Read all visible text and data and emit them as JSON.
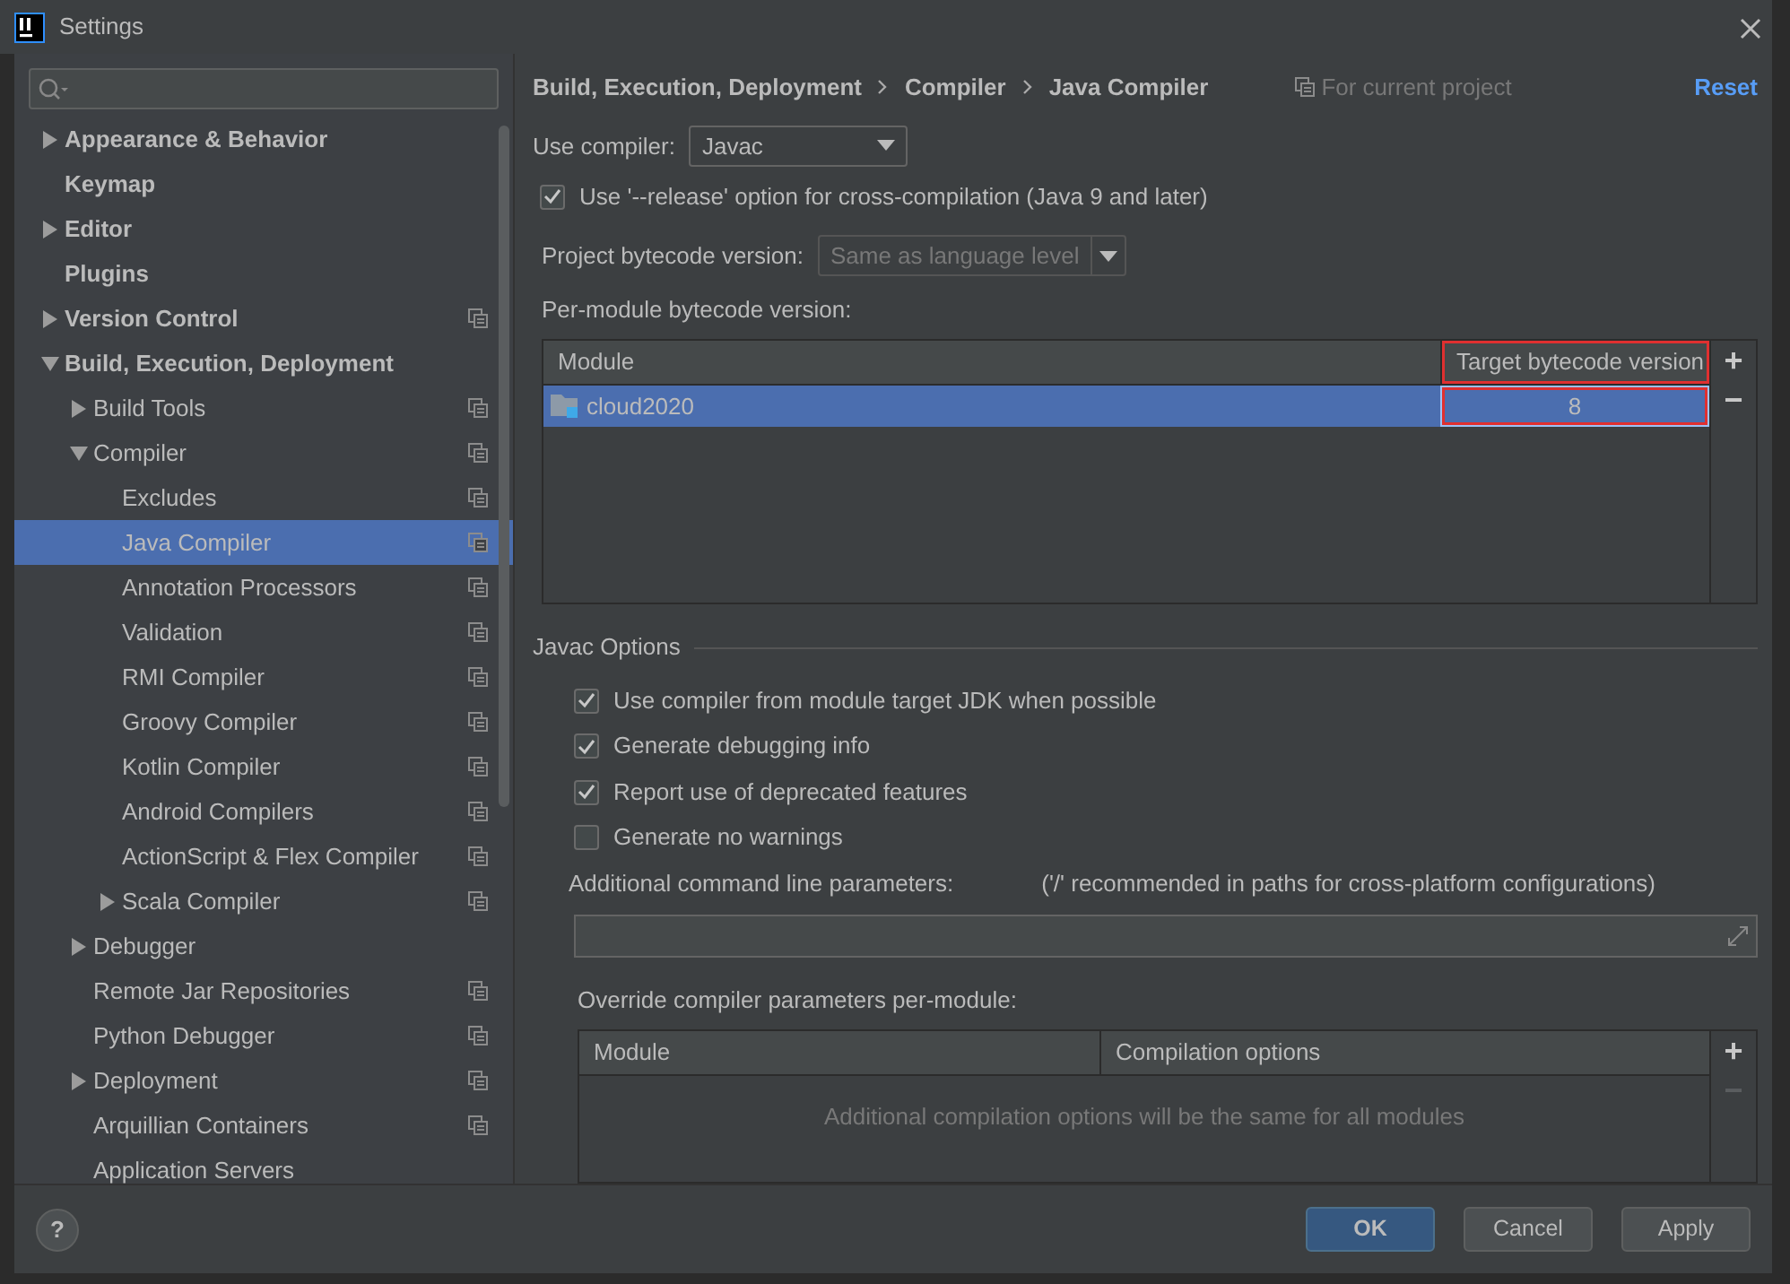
{
  "window": {
    "title": "Settings"
  },
  "sidebar": {
    "items": [
      {
        "label": "Appearance & Behavior",
        "expanded": false,
        "project_scoped": false,
        "selected": false
      },
      {
        "label": "Keymap",
        "project_scoped": false,
        "selected": false
      },
      {
        "label": "Editor",
        "expanded": false,
        "project_scoped": false,
        "selected": false
      },
      {
        "label": "Plugins",
        "project_scoped": false,
        "selected": false
      },
      {
        "label": "Version Control",
        "expanded": false,
        "project_scoped": true,
        "selected": false
      },
      {
        "label": "Build, Execution, Deployment",
        "expanded": true,
        "project_scoped": false,
        "selected": false,
        "children": [
          {
            "label": "Build Tools",
            "expanded": false,
            "project_scoped": true,
            "selected": false
          },
          {
            "label": "Compiler",
            "expanded": true,
            "project_scoped": true,
            "selected": false,
            "children": [
              {
                "label": "Excludes",
                "project_scoped": true,
                "selected": false
              },
              {
                "label": "Java Compiler",
                "project_scoped": true,
                "selected": true
              },
              {
                "label": "Annotation Processors",
                "project_scoped": true,
                "selected": false
              },
              {
                "label": "Validation",
                "project_scoped": true,
                "selected": false
              },
              {
                "label": "RMI Compiler",
                "project_scoped": true,
                "selected": false
              },
              {
                "label": "Groovy Compiler",
                "project_scoped": true,
                "selected": false
              },
              {
                "label": "Kotlin Compiler",
                "project_scoped": true,
                "selected": false
              },
              {
                "label": "Android Compilers",
                "project_scoped": true,
                "selected": false
              },
              {
                "label": "ActionScript & Flex Compiler",
                "project_scoped": true,
                "selected": false
              },
              {
                "label": "Scala Compiler",
                "expanded": false,
                "project_scoped": true,
                "selected": false
              }
            ]
          },
          {
            "label": "Debugger",
            "expanded": false,
            "project_scoped": false,
            "selected": false
          },
          {
            "label": "Remote Jar Repositories",
            "project_scoped": true,
            "selected": false
          },
          {
            "label": "Python Debugger",
            "project_scoped": true,
            "selected": false
          },
          {
            "label": "Deployment",
            "expanded": false,
            "project_scoped": true,
            "selected": false
          },
          {
            "label": "Arquillian Containers",
            "project_scoped": true,
            "selected": false
          },
          {
            "label": "Application Servers",
            "project_scoped": false,
            "selected": false
          }
        ]
      }
    ]
  },
  "breadcrumb": [
    "Build, Execution, Deployment",
    "Compiler",
    "Java Compiler"
  ],
  "scope_note": "For current project",
  "reset_link": "Reset",
  "use_compiler": {
    "label": "Use compiler:",
    "value": "Javac"
  },
  "release_option": {
    "label": "Use '--release' option for cross-compilation (Java 9 and later)",
    "checked": true
  },
  "project_bytecode": {
    "label": "Project bytecode version:",
    "placeholder": "Same as language level",
    "disabled": true
  },
  "per_module": {
    "label": "Per-module bytecode version:",
    "columns": [
      {
        "title": "Module",
        "highlighted": false
      },
      {
        "title": "Target bytecode version",
        "highlighted": true
      }
    ],
    "rows": [
      {
        "module": "cloud2020",
        "version": "8",
        "selected": true
      }
    ],
    "add_button": "+",
    "remove_button": "−"
  },
  "javac_options": {
    "title": "Javac Options",
    "checkboxes": [
      {
        "label": "Use compiler from module target JDK when possible",
        "checked": true
      },
      {
        "label": "Generate debugging info",
        "checked": true
      },
      {
        "label": "Report use of deprecated features",
        "checked": true
      },
      {
        "label": "Generate no warnings",
        "checked": false
      }
    ],
    "additional_params": {
      "label": "Additional command line parameters:",
      "hint": "('/' recommended in paths for cross-platform configurations)"
    },
    "override": {
      "label": "Override compiler parameters per-module:",
      "columns": [
        "Module",
        "Compilation options"
      ],
      "empty_text": "Additional compilation options will be the same for all modules",
      "add_button": "+",
      "remove_button": "−",
      "remove_disabled": true
    }
  },
  "buttons": [
    {
      "label": "OK",
      "default": true
    },
    {
      "label": "Cancel",
      "default": false
    },
    {
      "label": "Apply",
      "default": false
    }
  ],
  "help_button": "?"
}
